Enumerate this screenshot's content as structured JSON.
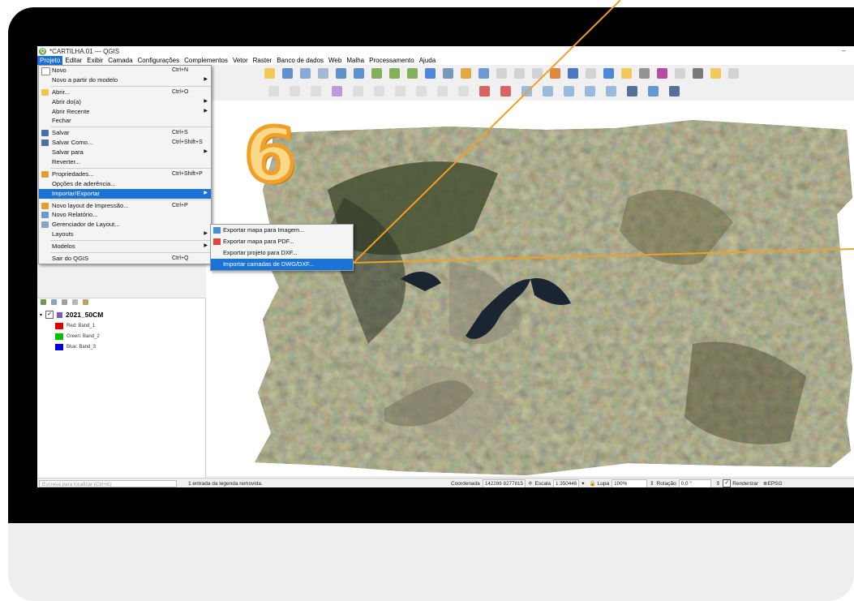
{
  "window": {
    "title": "*CARTILHA.01 — QGIS",
    "minimize": "–"
  },
  "menubar": [
    "Projeto",
    "Editar",
    "Exibir",
    "Camada",
    "Configurações",
    "Complementos",
    "Vetor",
    "Raster",
    "Banco de dados",
    "Web",
    "Malha",
    "Processamento",
    "Ajuda"
  ],
  "project_menu": [
    {
      "label": "Novo",
      "shortcut": "Ctrl+N",
      "icon": "new-file-icon"
    },
    {
      "label": "Novo a partir do modelo",
      "submenu": true
    },
    {
      "sep": true
    },
    {
      "label": "Abrir...",
      "shortcut": "Ctrl+O",
      "icon": "folder-icon"
    },
    {
      "label": "Abrir do(a)",
      "submenu": true
    },
    {
      "label": "Abrir Recente",
      "submenu": true
    },
    {
      "label": "Fechar"
    },
    {
      "sep": true
    },
    {
      "label": "Salvar",
      "shortcut": "Ctrl+S",
      "icon": "save-icon"
    },
    {
      "label": "Salvar Como...",
      "shortcut": "Ctrl+Shift+S",
      "icon": "save-as-icon"
    },
    {
      "label": "Salvar para",
      "submenu": true
    },
    {
      "label": "Reverter..."
    },
    {
      "sep": true
    },
    {
      "label": "Propriedades...",
      "shortcut": "Ctrl+Shift+P",
      "icon": "properties-icon"
    },
    {
      "label": "Opções de aderência..."
    },
    {
      "label": "Importar/Exportar",
      "submenu": true,
      "highlight": true
    },
    {
      "sep": true
    },
    {
      "label": "Novo layout de Impressão...",
      "shortcut": "Ctrl+P",
      "icon": "new-layout-icon"
    },
    {
      "label": "Novo Relatório...",
      "icon": "report-icon"
    },
    {
      "label": "Gerenciador de Layout...",
      "icon": "layout-manager-icon"
    },
    {
      "label": "Layouts",
      "submenu": true
    },
    {
      "sep": true
    },
    {
      "label": "Modelos",
      "submenu": true
    },
    {
      "sep": true
    },
    {
      "label": "Sair do QGIS",
      "shortcut": "Ctrl+Q"
    }
  ],
  "import_export_submenu": [
    {
      "label": "Exportar mapa para Imagem...",
      "icon": "export-image-icon"
    },
    {
      "label": "Exportar mapa para PDF...",
      "icon": "export-pdf-icon"
    },
    {
      "label": "Exportar projeto para DXF..."
    },
    {
      "label": "Importar camadas de DWG/DXF...",
      "highlight": true
    }
  ],
  "layers": {
    "name": "2021_50CM",
    "checked": "✓",
    "bands": [
      {
        "label": "Red: Band_1",
        "color": "#e00000"
      },
      {
        "label": "Green: Band_2",
        "color": "#00c000"
      },
      {
        "label": "Blue: Band_3",
        "color": "#0000e0"
      }
    ]
  },
  "status": {
    "search_placeholder": "Escreva para localizar (Ctrl+K)",
    "message": "1 entrada da legenda removida.",
    "coord_label": "Coordenada",
    "coord_value": "142286 8277815",
    "scale_label": "Escala",
    "scale_value": "1:350446",
    "magnifier_label": "Lupa",
    "magnifier_value": "100%",
    "rotation_label": "Rotação",
    "rotation_value": "0,0 °",
    "render_label": "Renderizar",
    "epsg": "EPSG"
  },
  "step_number": "6",
  "colors": {
    "accent": "#1a73d9",
    "callout": "#f0a028"
  }
}
